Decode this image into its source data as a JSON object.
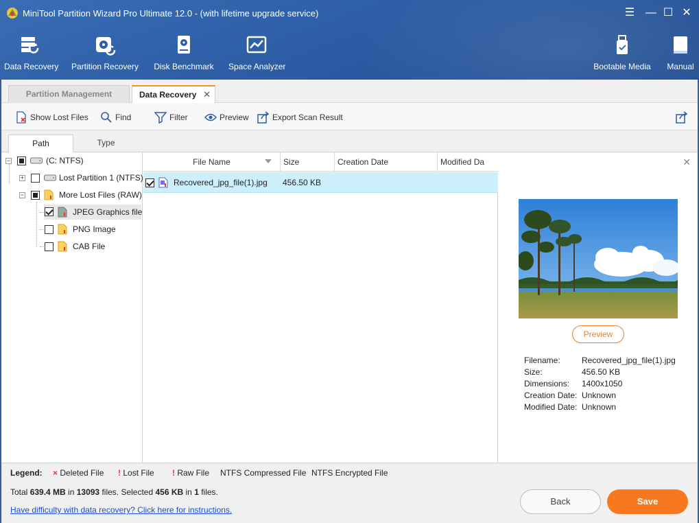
{
  "window": {
    "title": "MiniTool Partition Wizard Pro Ultimate 12.0 - (with lifetime upgrade service)",
    "controls": {
      "menu": "☰",
      "minimize": "—",
      "maximize": "☐",
      "close": "✕"
    }
  },
  "toolbar": {
    "data_recovery": "Data Recovery",
    "partition_recovery": "Partition Recovery",
    "disk_benchmark": "Disk Benchmark",
    "space_analyzer": "Space Analyzer",
    "bootable_media": "Bootable Media",
    "manual": "Manual"
  },
  "tabs": {
    "partition_management": "Partition Management",
    "data_recovery": "Data Recovery",
    "close": "✕"
  },
  "actions": {
    "show_lost_files": "Show Lost Files",
    "find": "Find",
    "filter": "Filter",
    "preview": "Preview",
    "export": "Export Scan Result"
  },
  "subtabs": {
    "path": "Path",
    "type": "Type"
  },
  "tree": {
    "root": "(C: NTFS)",
    "lost_partition": "Lost Partition 1 (NTFS)",
    "more_lost": "More Lost Files (RAW)",
    "jpeg": "JPEG Graphics file",
    "png": "PNG Image",
    "cab": "CAB File"
  },
  "columns": {
    "file_name": "File Name",
    "size": "Size",
    "creation_date": "Creation Date",
    "modified_date": "Modified Da"
  },
  "files": [
    {
      "name": "Recovered_jpg_file(1).jpg",
      "size": "456.50 KB",
      "creation": "",
      "modified": ""
    }
  ],
  "preview": {
    "close": "✕",
    "button": "Preview",
    "filename_label": "Filename:",
    "filename": "Recovered_jpg_file(1).jpg",
    "size_label": "Size:",
    "size": "456.50 KB",
    "dimensions_label": "Dimensions:",
    "dimensions": "1400x1050",
    "creation_label": "Creation Date:",
    "creation": "Unknown",
    "modified_label": "Modified Date:",
    "modified": "Unknown"
  },
  "legend": {
    "title": "Legend:",
    "deleted": "Deleted File",
    "lost": "Lost File",
    "raw": "Raw File",
    "compressed": "NTFS Compressed File",
    "encrypted": "NTFS Encrypted File"
  },
  "summary": {
    "p1": "Total ",
    "total_size": "639.4 MB",
    "p2": " in ",
    "total_files": "13093",
    "p3": " files.  Selected ",
    "sel_size": "456 KB",
    "p4": " in ",
    "sel_files": "1",
    "p5": " files."
  },
  "help_link": "Have difficulty with data recovery? Click here for instructions.",
  "buttons": {
    "back": "Back",
    "save": "Save"
  },
  "colors": {
    "accent": "#f7781e",
    "header": "#2d5ea6",
    "selection": "#cdeefb",
    "link": "#1a4fd8"
  }
}
